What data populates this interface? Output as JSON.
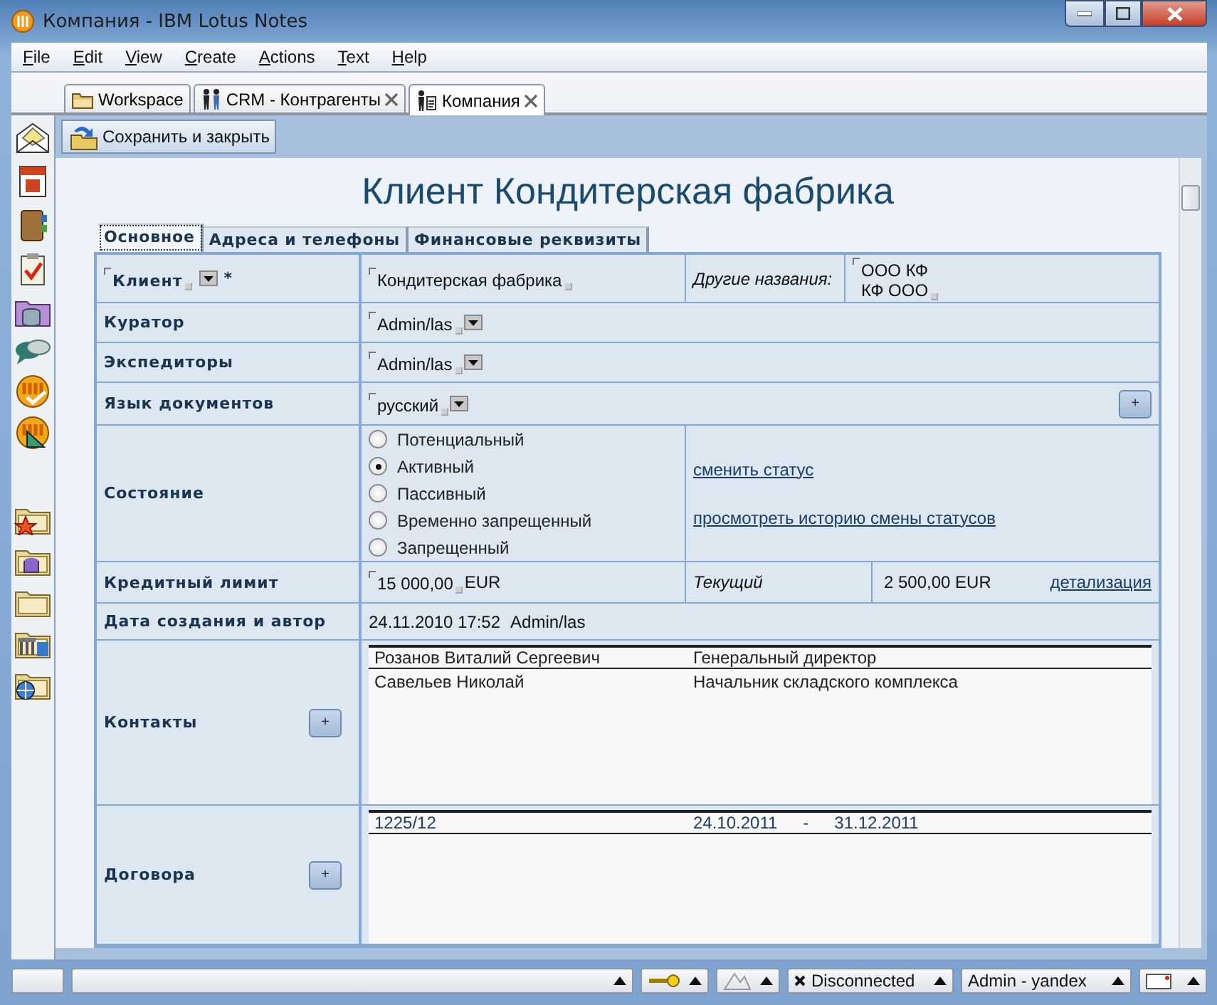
{
  "window": {
    "title": "Компания - IBM Lotus Notes"
  },
  "menu": [
    "File",
    "Edit",
    "View",
    "Create",
    "Actions",
    "Text",
    "Help"
  ],
  "tabs": [
    {
      "kind": "workspace",
      "label": "Workspace",
      "selected": false,
      "closable": false
    },
    {
      "kind": "database",
      "label": "CRM - Контрагенты",
      "selected": false,
      "closable": true
    },
    {
      "kind": "document",
      "label": "Компания",
      "selected": true,
      "closable": true
    }
  ],
  "action_bar": {
    "buttons": [
      "Сохранить и закрыть"
    ]
  },
  "document": {
    "title": "Клиент Кондитерская фабрика",
    "tabs": [
      {
        "label": "Основное",
        "selected": true
      },
      {
        "label": "Адреса и телефоны",
        "selected": false
      },
      {
        "label": "Финансовые реквизиты",
        "selected": false
      }
    ],
    "rows": [
      {
        "kind": "client",
        "label": "Клиент",
        "required_mark": "*",
        "value": "Кондитерская фабрика",
        "other_label": "Другие названия:",
        "other_values": [
          "ООО КФ",
          "КФ ООО"
        ]
      },
      {
        "kind": "select",
        "label": "Куратор",
        "value": "Admin/las"
      },
      {
        "kind": "select",
        "label": "Экспедиторы",
        "value": "Admin/las"
      },
      {
        "kind": "select",
        "label": "Язык документов",
        "value": "русский",
        "add_button": "+"
      },
      {
        "kind": "status",
        "label": "Состояние",
        "options": [
          {
            "label": "Потенциальный",
            "selected": false
          },
          {
            "label": "Активный",
            "selected": true
          },
          {
            "label": "Пассивный",
            "selected": false
          },
          {
            "label": "Временно запрещенный",
            "selected": false
          },
          {
            "label": "Запрещенный",
            "selected": false
          }
        ],
        "links": [
          "сменить статус",
          "просмотреть историю смены статусов"
        ]
      },
      {
        "kind": "credit",
        "label": "Кредитный лимит",
        "value": "15 000,00",
        "currency": "EUR",
        "current_label": "Текущий",
        "current_value": "2 500,00 EUR",
        "link": "детализация"
      },
      {
        "kind": "created",
        "label": "Дата создания и автор",
        "date": "24.11.2010 17:52",
        "author": "Admin/las"
      },
      {
        "kind": "list",
        "label": "Контакты",
        "add_button": "+",
        "items": [
          {
            "cells": [
              "Розанов Виталий Сергеевич",
              "Генеральный директор"
            ]
          },
          {
            "cells": [
              "Савельев Николай",
              "Начальник складского комплекса"
            ]
          }
        ]
      },
      {
        "kind": "list",
        "label": "Договора",
        "add_button": "+",
        "items": [
          {
            "cells": [
              "1225/12",
              "24.10.2011",
              "-",
              "31.12.2011"
            ]
          }
        ]
      }
    ]
  },
  "status_bar": {
    "segments": [
      {
        "kind": "blank"
      },
      {
        "kind": "message"
      },
      {
        "kind": "key"
      },
      {
        "kind": "signature"
      },
      {
        "kind": "location",
        "text": "Disconnected"
      },
      {
        "kind": "user",
        "text": "Admin - yandex"
      },
      {
        "kind": "mail"
      }
    ]
  }
}
